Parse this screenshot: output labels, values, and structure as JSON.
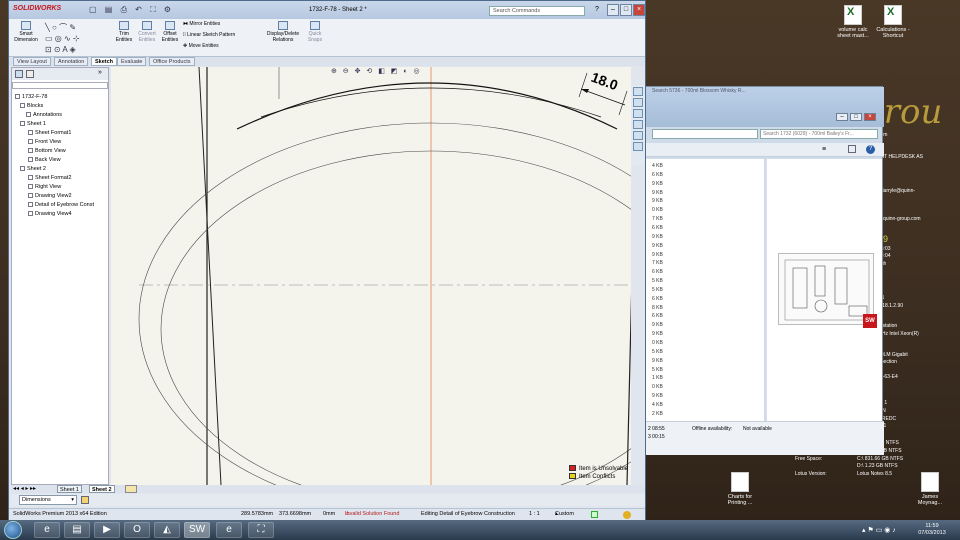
{
  "desktop": {
    "logo_fragment": "grou",
    "icons": [
      {
        "label": "volume calc sheet mast...",
        "type": "excel"
      },
      {
        "label": "Calculations - Shortcut",
        "type": "excel"
      },
      {
        "label": "Charts for Printing ...",
        "type": "folder"
      },
      {
        "label": "James Moynag...",
        "type": "folder"
      }
    ],
    "bginfo": {
      "lines": [
        "com",
        "E IT HELPDESK AS",
        "_darryle@quinn-",
        "@quinn-group.com",
        "79",
        "08:03",
        "08:04",
        "agh",
        "C1",
        "1 18.1.2.90",
        "orstation",
        "GHz Intel Xeon(R)",
        "79LM Gigabit",
        "nnection",
        "IB-63-E4",
        "ck 1",
        "LIN",
        "OREDC",
        "421"
      ],
      "free_space_label": "Free Space:",
      "free_space_values": [
        "C:\\ 831.66 GB NTFS",
        "D:\\ 1.23 GB NTFS"
      ],
      "lotus_label": "Lotus Version:",
      "lotus_value": "Lotus Notes 8.5",
      "ntfs_lines": [
        "B NTFS",
        "3B NTFS"
      ]
    }
  },
  "explorer": {
    "search_placeholder": "Search 1732 (6029) - 700ml Bailey's Fr...",
    "partial_search": "Search 5736 - 700ml Blossom Whisky R...",
    "sizes": [
      "4 KB",
      "6 KB",
      "9 KB",
      "9 KB",
      "9 KB",
      "0 KB",
      "7 KB",
      "6 KB",
      "9 KB",
      "9 KB",
      "9 KB",
      "7 KB",
      "6 KB",
      "5 KB",
      "5 KB",
      "6 KB",
      "8 KB",
      "6 KB",
      "9 KB",
      "9 KB",
      "0 KB",
      "5 KB",
      "9 KB",
      "5 KB",
      "1 KB",
      "0 KB",
      "9 KB",
      "4 KB",
      "2 KB"
    ],
    "dates": [
      "2 08:55",
      "3 00:15"
    ],
    "offline_label": "Offline availability:",
    "offline_value": "Not available"
  },
  "solidworks": {
    "brand": "SOLIDWORKS",
    "doc_title": "1732-F-78 - Sheet 2 *",
    "search_placeholder": "Search Commands",
    "ribbon": {
      "smart_dimension": "Smart Dimension",
      "trim": "Trim Entities",
      "convert": "Convert Entities",
      "offset": "Offset Entities",
      "mirror": "Mirror Entities",
      "linear_pattern": "Linear Sketch Pattern",
      "move": "Move Entities",
      "display_relations": "Display/Delete Relations",
      "quick_snaps": "Quick Snaps"
    },
    "tabs": [
      "View Layout",
      "Annotation",
      "Sketch",
      "Evaluate",
      "Office Products"
    ],
    "active_tab": "Sketch",
    "tree": {
      "root": "1732-F-78",
      "items": [
        "Blocks",
        "Annotations",
        "Sheet 1",
        "Sheet Format1",
        "Front View",
        "Bottom View",
        "Back View",
        "Sheet 2",
        "Sheet Format2",
        "Right View",
        "Drawing View2",
        "Detail of Eyebrow Const",
        "Drawing View4"
      ]
    },
    "dimension_value": "18.0",
    "legend": [
      "Item is Unsolvable",
      "Item Conflicts"
    ],
    "legend_colors": [
      "#d42020",
      "#e6d21e"
    ],
    "sheet_tabs": [
      "Sheet 1",
      "Sheet 2"
    ],
    "active_sheet": "Sheet 2",
    "dimensions_select": "Dimensions",
    "status": {
      "edition": "SolidWorks Premium 2013 x64 Edition",
      "x": "289.5783mm",
      "y": "373.6698mm",
      "z": "0mm",
      "solution": "Invalid Solution Found",
      "editing": "Editing Detail of Eyebrow Construction",
      "scale": "1 : 1",
      "units": "Custom"
    }
  },
  "taskbar": {
    "time": "11:59",
    "date": "07/03/2013"
  }
}
